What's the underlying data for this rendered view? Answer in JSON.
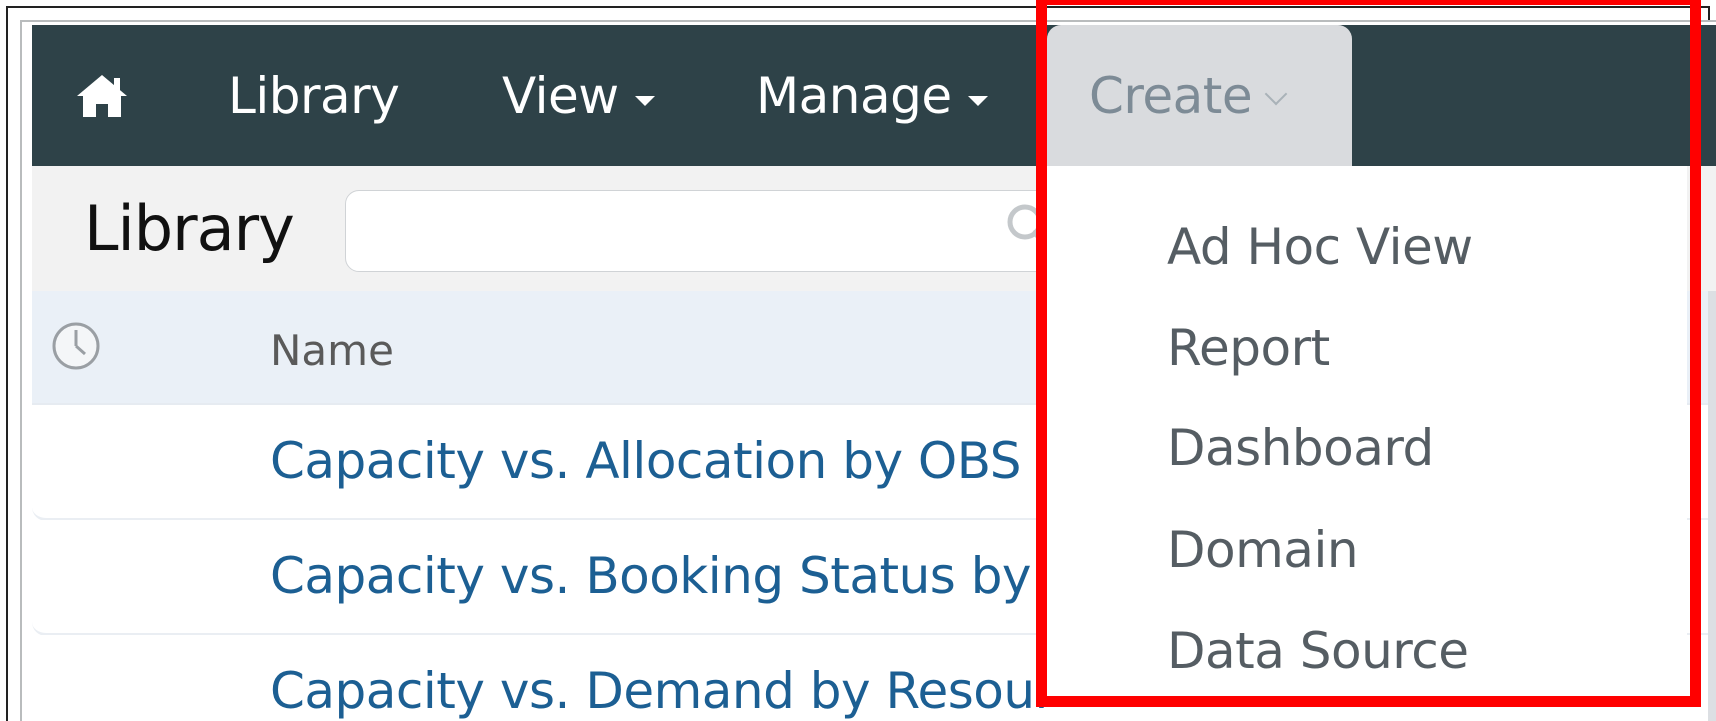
{
  "navbar": {
    "home_icon": "home-icon",
    "library_label": "Library",
    "view_label": "View",
    "manage_label": "Manage",
    "create_label": "Create"
  },
  "toolbar": {
    "title": "Library",
    "search": {
      "value": "",
      "placeholder": "",
      "icon": "search-icon"
    }
  },
  "table": {
    "columns": [
      {
        "icon": "clock-icon",
        "label": "Name"
      }
    ],
    "rows": [
      {
        "name": "Capacity vs. Allocation by OBS"
      },
      {
        "name": "Capacity vs. Booking Status by O"
      },
      {
        "name": "Capacity vs. Demand by Resourc"
      }
    ]
  },
  "create_menu": {
    "items": [
      {
        "label": "Ad Hoc View"
      },
      {
        "label": "Report"
      },
      {
        "label": "Dashboard"
      },
      {
        "label": "Domain"
      },
      {
        "label": "Data Source"
      }
    ]
  },
  "highlight": {
    "color": "#ff0000"
  },
  "colors": {
    "navbar_bg": "#2e4248",
    "link": "#1c5f93",
    "menu_text": "#555d63",
    "active_tab_bg": "#d9dbde"
  }
}
